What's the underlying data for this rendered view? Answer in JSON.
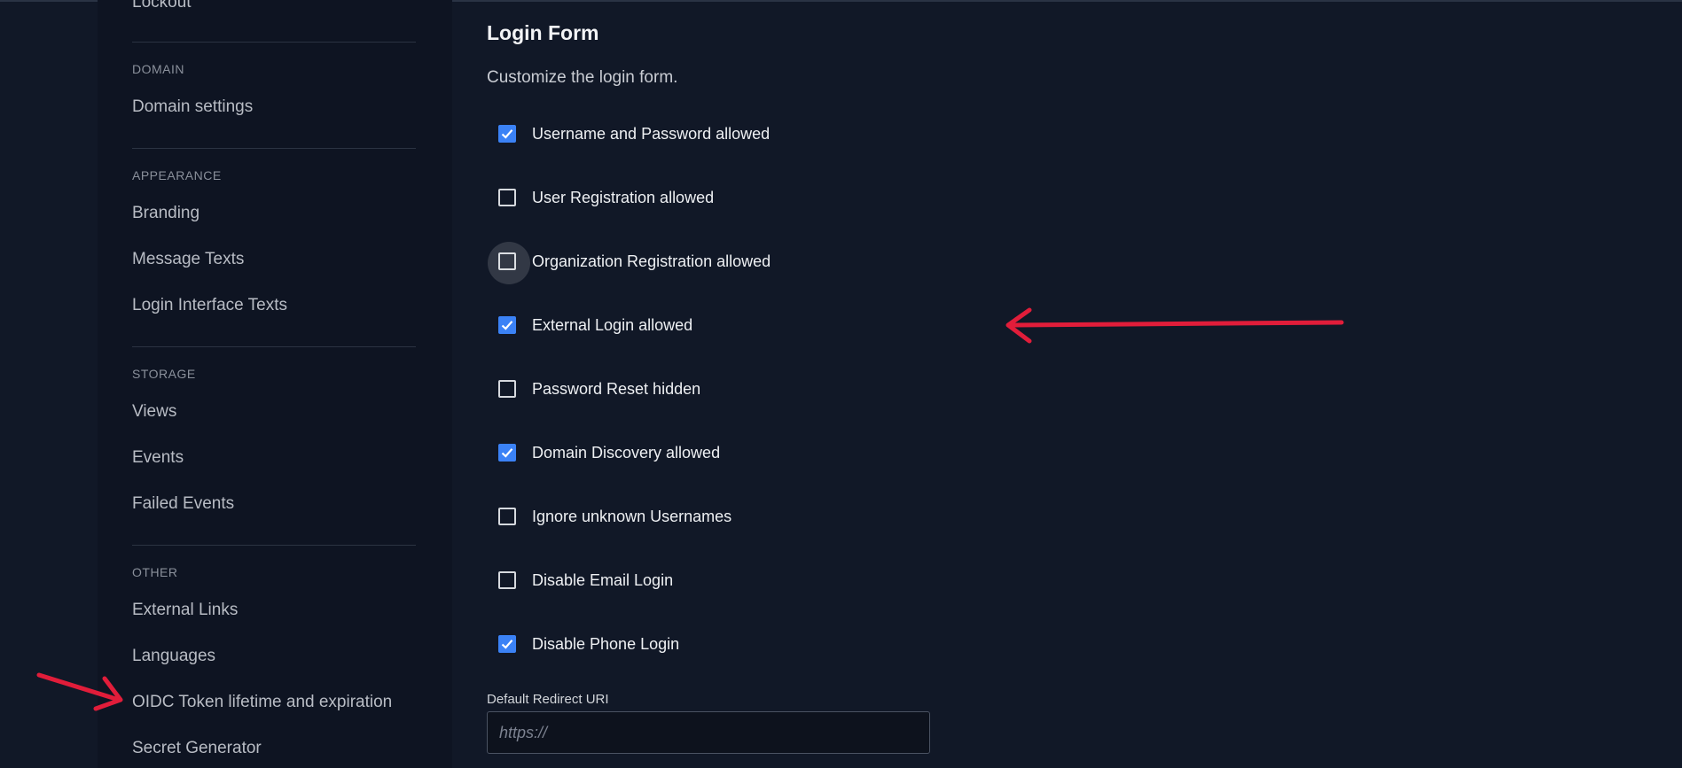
{
  "sidebar": {
    "top_item": "Lockout",
    "sections": [
      {
        "heading": "DOMAIN",
        "items": [
          "Domain settings"
        ]
      },
      {
        "heading": "APPEARANCE",
        "items": [
          "Branding",
          "Message Texts",
          "Login Interface Texts"
        ]
      },
      {
        "heading": "STORAGE",
        "items": [
          "Views",
          "Events",
          "Failed Events"
        ]
      },
      {
        "heading": "OTHER",
        "items": [
          "External Links",
          "Languages",
          "OIDC Token lifetime and expiration",
          "Secret Generator"
        ]
      }
    ]
  },
  "main": {
    "title": "Login Form",
    "description": "Customize the login form.",
    "options": [
      {
        "label": "Username and Password allowed",
        "checked": true
      },
      {
        "label": "User Registration allowed",
        "checked": false
      },
      {
        "label": "Organization Registration allowed",
        "checked": false
      },
      {
        "label": "External Login allowed",
        "checked": true
      },
      {
        "label": "Password Reset hidden",
        "checked": false
      },
      {
        "label": "Domain Discovery allowed",
        "checked": true
      },
      {
        "label": "Ignore unknown Usernames",
        "checked": false
      },
      {
        "label": "Disable Email Login",
        "checked": false
      },
      {
        "label": "Disable Phone Login",
        "checked": true
      }
    ],
    "redirect_field": {
      "label": "Default Redirect URI",
      "placeholder": "https://",
      "value": ""
    }
  },
  "colors": {
    "background": "#111827",
    "sidebar": "#0e1422",
    "accent": "#3b82f6",
    "annotation": "#e11d3a"
  }
}
